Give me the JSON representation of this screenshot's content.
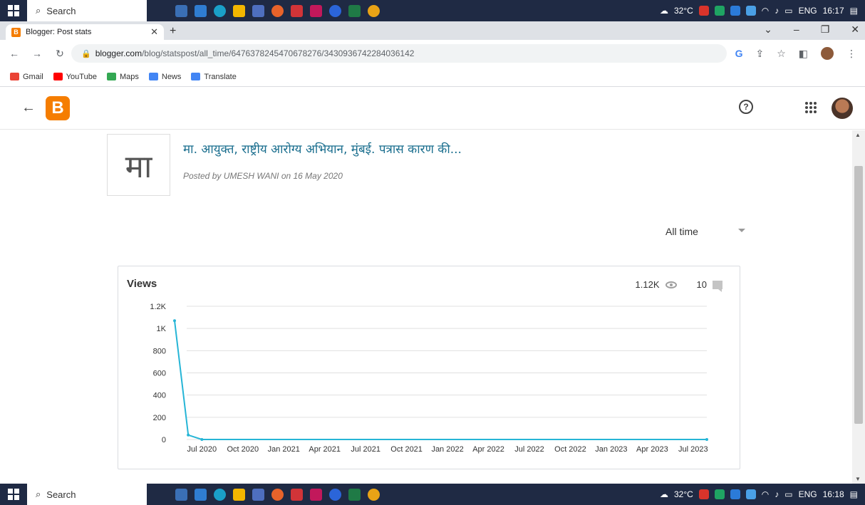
{
  "taskbar": {
    "search_label": "Search",
    "temperature": "32°C",
    "language": "ENG",
    "time_top": "16:17",
    "time_bottom": "16:18"
  },
  "browser": {
    "tab_title": "Blogger: Post stats",
    "url_host": "blogger.com",
    "url_path": "/blog/statspost/all_time/6476378245470678276/3430936742284036142",
    "bookmarks": [
      "Gmail",
      "YouTube",
      "Maps",
      "News",
      "Translate"
    ]
  },
  "post": {
    "thumb_text": "मा",
    "title": "मा. आयुक्त, राष्ट्रीय आरोग्य अभियान, मुंबई. पत्रास कारण की...",
    "meta": "Posted by UMESH WANI on 16 May 2020"
  },
  "range": {
    "selected": "All time"
  },
  "card": {
    "title": "Views",
    "views_total": "1.12K",
    "comments_total": "10"
  },
  "colors": {
    "line": "#26b5d6",
    "blogger_orange": "#f57d00"
  },
  "chart_data": {
    "type": "line",
    "title": "Views",
    "y_tick_labels": [
      "0",
      "200",
      "400",
      "600",
      "800",
      "1K",
      "1.2K"
    ],
    "ylim": [
      0,
      1200
    ],
    "x_tick_labels": [
      "Jul 2020",
      "Oct 2020",
      "Jan 2021",
      "Apr 2021",
      "Jul 2021",
      "Oct 2021",
      "Jan 2022",
      "Apr 2022",
      "Jul 2022",
      "Oct 2022",
      "Jan 2023",
      "Apr 2023",
      "Jul 2023"
    ],
    "x": [
      "May 2020",
      "Jun 2020",
      "Jul 2020",
      "Aug 2023"
    ],
    "values": [
      1070,
      40,
      0,
      0
    ],
    "grid": true,
    "legend": false
  }
}
